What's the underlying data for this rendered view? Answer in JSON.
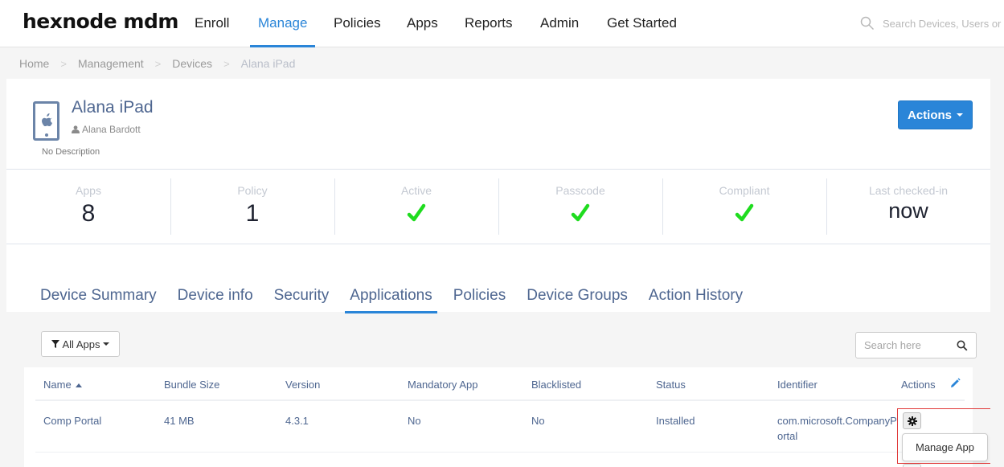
{
  "topnav": {
    "logo": "hexnode mdm",
    "items": [
      {
        "label": "Enroll",
        "active": false
      },
      {
        "label": "Manage",
        "active": true
      },
      {
        "label": "Policies",
        "active": false
      },
      {
        "label": "Apps",
        "active": false
      },
      {
        "label": "Reports",
        "active": false
      },
      {
        "label": "Admin",
        "active": false
      },
      {
        "label": "Get Started",
        "active": false
      }
    ],
    "search_placeholder": "Search Devices, Users or P",
    "search_icon": "search-icon"
  },
  "breadcrumb": {
    "items": [
      "Home",
      "Management",
      "Devices"
    ],
    "current": "Alana iPad",
    "separator": ">"
  },
  "device": {
    "icon": "ipad-apple-icon",
    "name": "Alana iPad",
    "user_icon": "user-icon",
    "user": "Alana Bardott",
    "description": "No Description",
    "actions_label": "Actions"
  },
  "stats": [
    {
      "label": "Apps",
      "value": "8",
      "type": "number"
    },
    {
      "label": "Policy",
      "value": "1",
      "type": "number"
    },
    {
      "label": "Active",
      "value": "yes",
      "type": "check"
    },
    {
      "label": "Passcode",
      "value": "yes",
      "type": "check"
    },
    {
      "label": "Compliant",
      "value": "yes",
      "type": "check"
    },
    {
      "label": "Last checked-in",
      "value": "now",
      "type": "text"
    }
  ],
  "tabs": [
    {
      "label": "Device Summary",
      "active": false
    },
    {
      "label": "Device info",
      "active": false
    },
    {
      "label": "Security",
      "active": false
    },
    {
      "label": "Applications",
      "active": true
    },
    {
      "label": "Policies",
      "active": false
    },
    {
      "label": "Device Groups",
      "active": false
    },
    {
      "label": "Action History",
      "active": false
    }
  ],
  "apps": {
    "filter_label": "All Apps",
    "search_placeholder": "Search here",
    "columns": [
      "Name",
      "Bundle Size",
      "Version",
      "Mandatory App",
      "Blacklisted",
      "Status",
      "Identifier",
      "Actions"
    ],
    "sorted_column": "Name",
    "sort_direction": "ascending",
    "rows": [
      {
        "name": "Comp Portal",
        "bundle_size": "41 MB",
        "version": "4.3.1",
        "mandatory": "No",
        "blacklisted": "No",
        "status": "Installed",
        "identifier": "com.microsoft.CompanyPortal"
      }
    ],
    "row_menu": {
      "items": [
        "Manage App"
      ]
    }
  },
  "colors": {
    "accent": "#2a85d8",
    "text_primary": "#4e6690",
    "check_green": "#1fdc1f",
    "highlight": "#e03a3a"
  }
}
